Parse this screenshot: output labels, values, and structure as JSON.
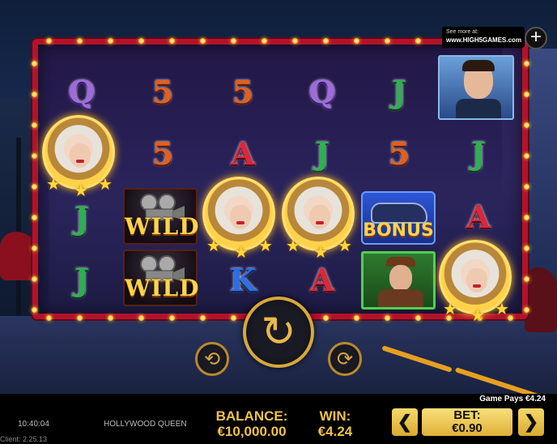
{
  "promo": {
    "see_more": "See more at:",
    "site": "www.HIGH5GAMES.com"
  },
  "reels": {
    "row1": [
      "Q",
      "5",
      "5",
      "Q",
      "J"
    ],
    "row2_letters": [
      "5",
      "A",
      "J",
      "5",
      "J"
    ],
    "row3_letters": [
      "J",
      "A"
    ],
    "row4_letters": [
      "J",
      "K",
      "A"
    ],
    "wild_label": "WILD",
    "bonus_label": "BONUS"
  },
  "controls": {
    "spin_icon": "↻",
    "autoplay_icon": "⟳",
    "turbo_icon": "⟲"
  },
  "status": {
    "game_pays": "Game Pays €4.24",
    "clock": "10:40:04",
    "game_name": "HOLLYWOOD QUEEN",
    "client": "Client: 2.25.13",
    "balance_label": "BALANCE:",
    "balance_value": "€10,000.00",
    "win_label": "WIN:",
    "win_value": "€4.24",
    "bet_label": "BET:",
    "bet_value": "€0.90",
    "prev_arrow": "❮",
    "next_arrow": "❯"
  },
  "colors": {
    "frame": "#b3122a",
    "gold": "#f0c248",
    "bar": "#000000"
  }
}
